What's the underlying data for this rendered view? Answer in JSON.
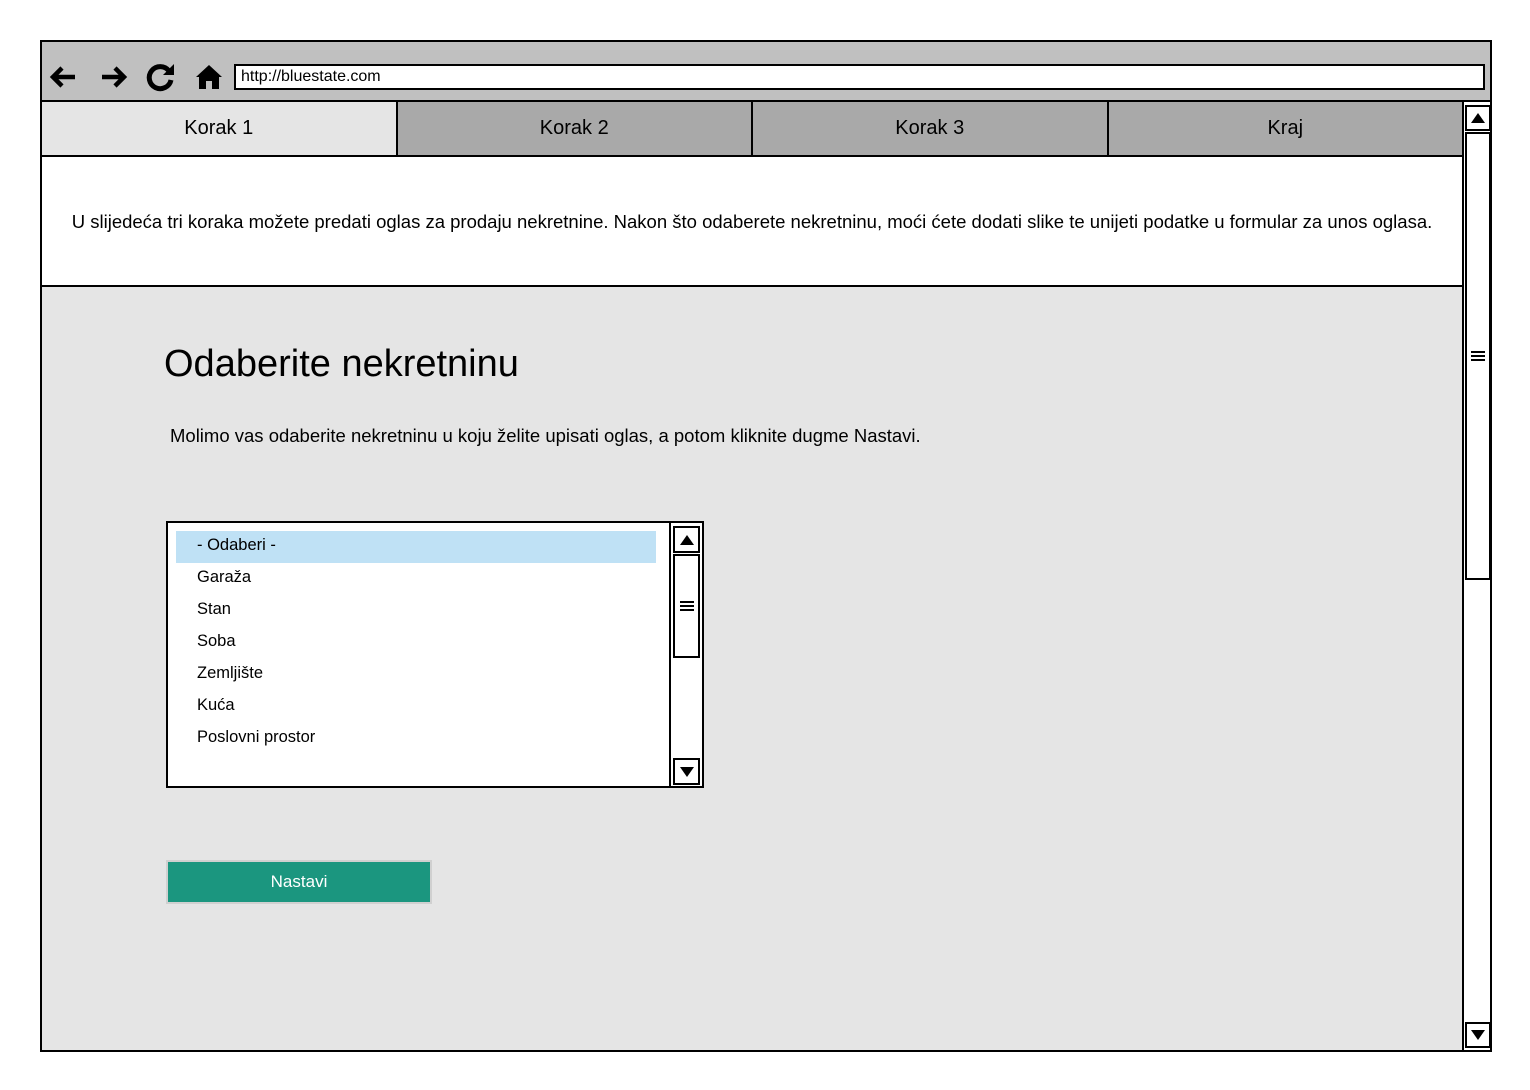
{
  "browser": {
    "url": "http://bluestate.com",
    "nav_icons": [
      "back-arrow-icon",
      "forward-arrow-icon",
      "reload-icon",
      "home-icon"
    ]
  },
  "tabs": [
    {
      "label": "Korak 1",
      "active": true
    },
    {
      "label": "Korak 2",
      "active": false
    },
    {
      "label": "Korak 3",
      "active": false
    },
    {
      "label": "Kraj",
      "active": false
    }
  ],
  "intro": {
    "text": "U slijedeća tri koraka možete predati oglas za prodaju nekretnine. Nakon što odaberete nekretninu, moći ćete dodati slike te unijeti podatke u formular za unos oglasa."
  },
  "main": {
    "title": "Odaberite nekretninu",
    "instruction": "Molimo vas odaberite nekretninu u koju želite upisati oglas, a potom kliknite dugme Nastavi.",
    "listbox": {
      "selected_index": 0,
      "options": [
        "- Odaberi -",
        "Garaža",
        "Stan",
        "Soba",
        "Zemljište",
        "Kuća",
        "Poslovni prostor"
      ]
    },
    "continue_label": "Nastavi"
  },
  "colors": {
    "toolbar": "#c0c0c0",
    "tab_inactive": "#a9a9a9",
    "tab_active": "#e5e5e5",
    "content_bg": "#e5e5e5",
    "selection": "#bfe1f5",
    "button": "#1b967f"
  }
}
